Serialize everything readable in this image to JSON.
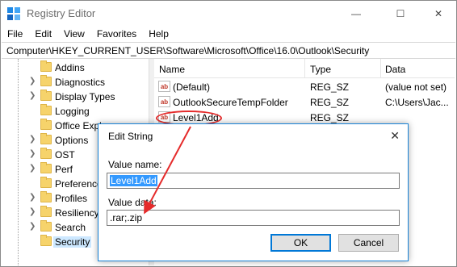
{
  "window": {
    "title": "Registry Editor",
    "minimize_glyph": "—",
    "maximize_glyph": "☐",
    "close_glyph": "✕"
  },
  "menu": [
    "File",
    "Edit",
    "View",
    "Favorites",
    "Help"
  ],
  "address": "Computer\\HKEY_CURRENT_USER\\Software\\Microsoft\\Office\\16.0\\Outlook\\Security",
  "tree": [
    {
      "label": "Addins",
      "expandable": false
    },
    {
      "label": "Diagnostics",
      "expandable": true
    },
    {
      "label": "Display Types",
      "expandable": true
    },
    {
      "label": "Logging",
      "expandable": false
    },
    {
      "label": "Office Explorer",
      "expandable": false
    },
    {
      "label": "Options",
      "expandable": true
    },
    {
      "label": "OST",
      "expandable": true
    },
    {
      "label": "Perf",
      "expandable": true
    },
    {
      "label": "Preferences",
      "expandable": false
    },
    {
      "label": "Profiles",
      "expandable": true
    },
    {
      "label": "Resiliency",
      "expandable": true
    },
    {
      "label": "Search",
      "expandable": true
    },
    {
      "label": "Security",
      "expandable": false,
      "selected": true
    }
  ],
  "list": {
    "headers": {
      "name": "Name",
      "type": "Type",
      "data": "Data"
    },
    "rows": [
      {
        "icon": "ab",
        "name": "(Default)",
        "type": "REG_SZ",
        "data": "(value not set)"
      },
      {
        "icon": "ab",
        "name": "OutlookSecureTempFolder",
        "type": "REG_SZ",
        "data": "C:\\Users\\Jac..."
      },
      {
        "icon": "ab",
        "name": "Level1Add",
        "type": "REG_SZ",
        "data": ""
      }
    ]
  },
  "dialog": {
    "title": "Edit String",
    "close_glyph": "✕",
    "value_name_label": "Value name:",
    "value_name": "Level1Add",
    "value_data_label": "Value data:",
    "value_data": ".rar;.zip",
    "ok_label": "OK",
    "cancel_label": "Cancel"
  },
  "colors": {
    "accent": "#0078d7",
    "annotation_red": "#e52b2b",
    "folder": "#f6d36b",
    "selection": "#cde8ff"
  }
}
